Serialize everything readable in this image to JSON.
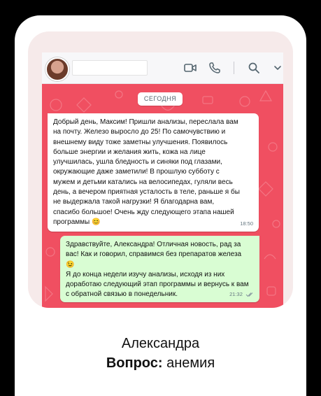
{
  "chat": {
    "date_label": "СЕГОДНЯ",
    "messages": [
      {
        "text": "Добрый день, Максим! Пришли анализы, переслала вам\nна почту. Железо выросло до 25! По самочувствию и\nвнешнему виду тоже заметны улучшения. Появилось\nбольше энергии и желания жить, кожа на лице\nулучшилась, ушла бледность и синяки под глазами,\nокружающие даже заметили! В прошлую субботу с\nмужем и детьми катались на велосипедах, гуляли весь\nдень, а вечером приятная усталость в теле, раньше я бы\nне выдержала такой нагрузки! Я благодарна вам,\nспасибо большое! Очень жду следующего этапа нашей\nпрограммы 😊",
        "time": "18:50"
      },
      {
        "text": "Здравствуйте, Александра! Отличная новость, рад за\nвас! Как и говорил, справимся без препаратов железа\n😉\nЯ до конца недели изучу анализы, исходя из них\nдоработаю следующий этап программы и вернусь к вам\nс обратной связью в понедельник.",
        "time": "21:32"
      }
    ]
  },
  "topbar": {
    "icons": [
      "video-call-icon",
      "phone-call-icon",
      "search-icon",
      "chevron-down-icon"
    ]
  },
  "caption": {
    "name": "Александра",
    "question_label": "Вопрос:",
    "question_value": " анемия"
  },
  "colors": {
    "chat_background": "#f04f61",
    "incoming_bubble": "#ffffff",
    "outgoing_bubble": "#d9fdd3"
  }
}
